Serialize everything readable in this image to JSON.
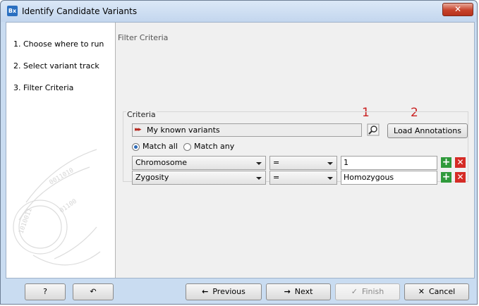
{
  "window": {
    "title": "Identify Candidate Variants",
    "app_icon_text": "Bx",
    "close_glyph": "✕"
  },
  "steps": [
    {
      "label": "1.  Choose where to run"
    },
    {
      "label": "2.  Select variant track"
    },
    {
      "label": "3.  Filter Criteria"
    }
  ],
  "panel": {
    "title": "Filter Criteria",
    "criteria_label": "Criteria",
    "track_name": "My known variants",
    "load_button": "Load Annotations",
    "callout_1": "1",
    "callout_2": "2",
    "match_all_label": "Match all",
    "match_any_label": "Match any",
    "match_selected": "all",
    "rows": [
      {
        "field": "Chromosome",
        "operator": "=",
        "value": "1"
      },
      {
        "field": "Zygosity",
        "operator": "=",
        "value": "Homozygous"
      }
    ]
  },
  "buttons": {
    "help": "?",
    "previous": "Previous",
    "next": "Next",
    "finish": "Finish",
    "cancel": "Cancel"
  },
  "colors": {
    "callout": "#c91f1f",
    "add": "#2f9a3b",
    "remove": "#d52b25",
    "titlebar": "#c9dcf1"
  }
}
